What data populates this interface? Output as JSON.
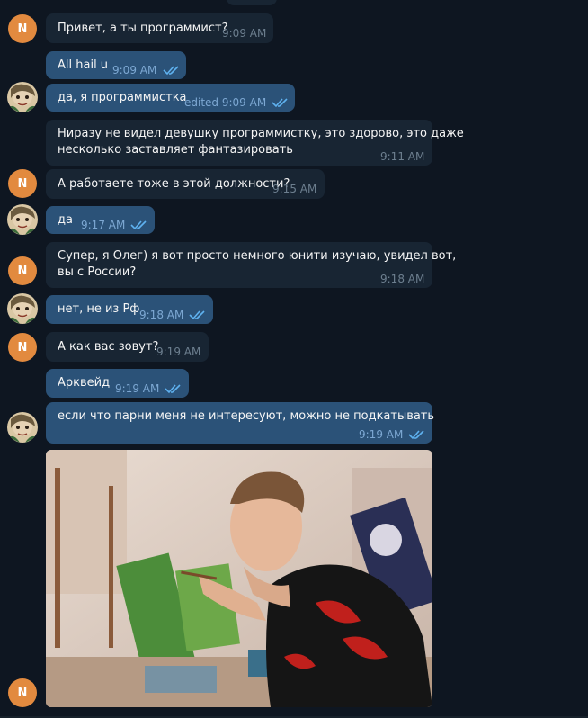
{
  "chat": {
    "avatar_n_letter": "N",
    "messages": [
      {
        "text": "Привет, а ты программист?",
        "time": "9:09 AM"
      },
      {
        "text": "All hail u",
        "time": "9:09 AM"
      },
      {
        "text": "да, я программистка",
        "time": "edited 9:09 AM"
      },
      {
        "text_line1": "Ниразу не видел девушку программистку, это здорово, это даже",
        "text_line2": "несколько заставляет фантазировать",
        "time": "9:11 AM"
      },
      {
        "text": "А работаете тоже в этой должности?",
        "time": "9:15 AM"
      },
      {
        "text": "да",
        "time": "9:17 AM"
      },
      {
        "text_line1": "Супер, я Олег) я вот просто немного юнити изучаю, увидел вот,",
        "text_line2": "вы с России?",
        "time": "9:18 AM"
      },
      {
        "text": "нет, не из Рф",
        "time": "9:18 AM"
      },
      {
        "text": "А как вас зовут?",
        "time": "9:19 AM"
      },
      {
        "text": "Арквейд",
        "time": "9:19 AM"
      },
      {
        "text": "если что парни меня не интересуют, можно не подкатывать",
        "time": "9:19 AM"
      }
    ]
  },
  "colors": {
    "background": "#0e1621",
    "incoming_bubble": "#182533",
    "outgoing_bubble": "#2b5278",
    "avatar_orange": "#e28a3f",
    "read_checks": "#5fb2f0"
  },
  "icons": {
    "read_receipt": "double-check-icon",
    "avatar_picture": "user-avatar-image"
  }
}
